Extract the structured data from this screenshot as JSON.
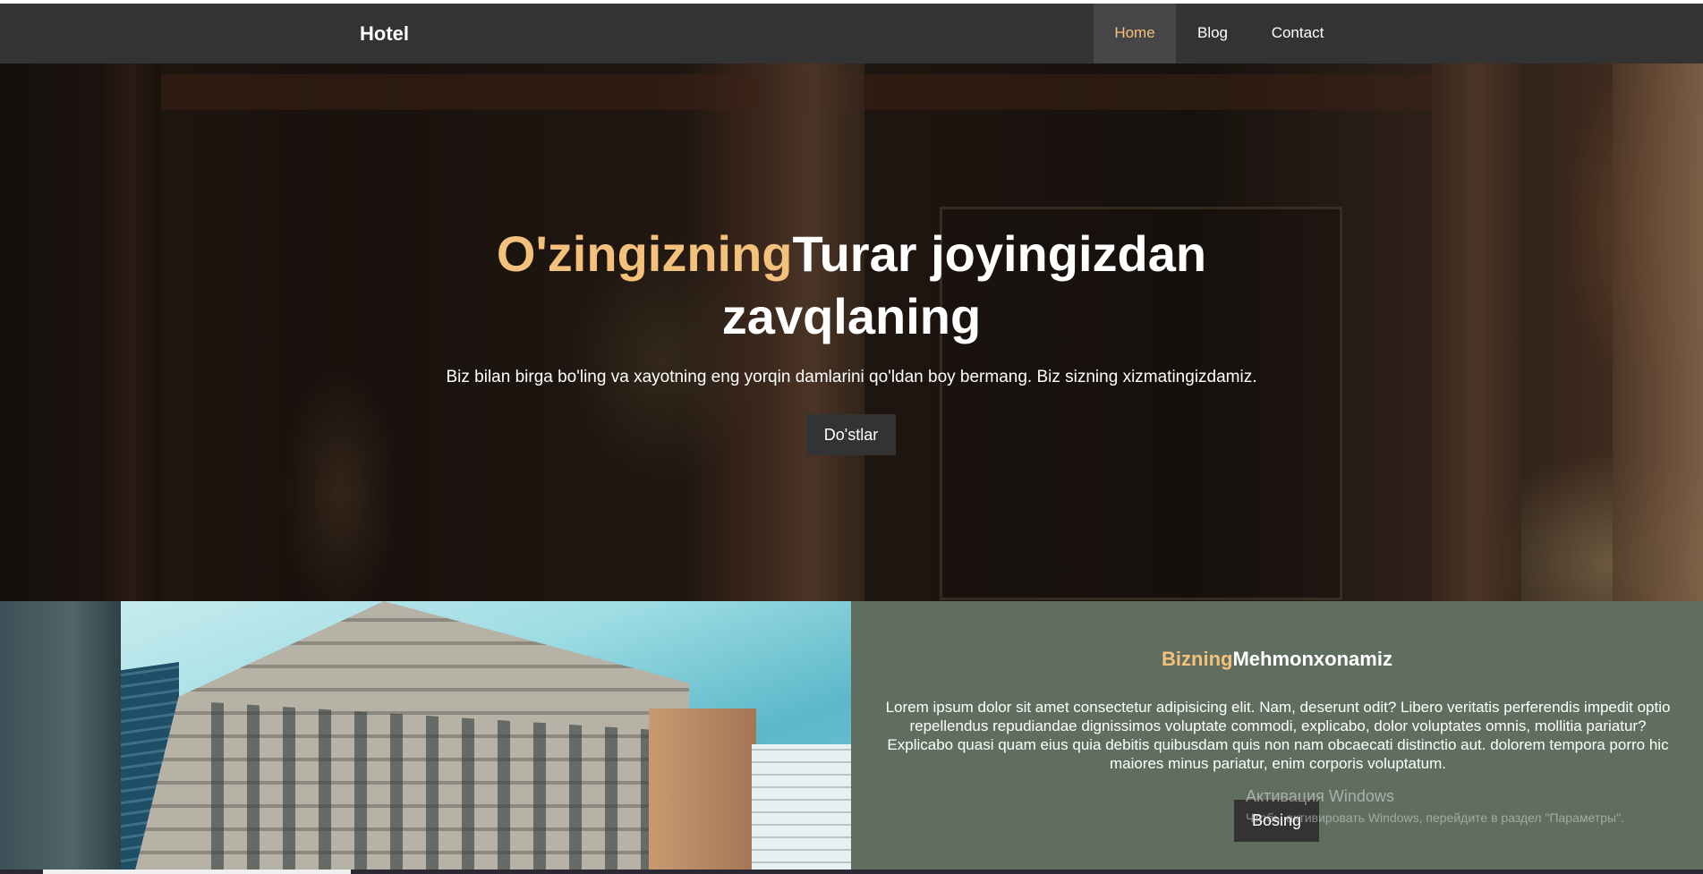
{
  "nav": {
    "logo": "Hotel",
    "items": [
      {
        "label": "Home",
        "active": true
      },
      {
        "label": "Blog",
        "active": false
      },
      {
        "label": "Contact",
        "active": false
      }
    ]
  },
  "hero": {
    "title_accent": "O'zingizning",
    "title_rest": "Turar joyingizdan zavqlaning",
    "subtitle": "Biz bilan birga bo'ling va xayotning eng yorqin damlarini qo'ldan boy bermang. Biz sizning xizmatingizdamiz.",
    "button_label": "Do'stlar"
  },
  "about": {
    "title_accent": "Bizning",
    "title_rest": "Mehmonxonamiz",
    "text": "Lorem ipsum dolor sit amet consectetur adipisicing elit. Nam, deserunt odit? Libero veritatis perferendis impedit optio repellendus repudiandae dignissimos voluptate commodi, explicabo, dolor voluptates omnis, mollitia pariatur? Explicabo quasi quam eius quia debitis quibusdam quis non nam obcaecati distinctio aut. dolorem tempora porro hic maiores minus pariatur, enim corporis voluptatum.",
    "button_label": "Bosing"
  },
  "os_watermark": {
    "title": "Активация Windows",
    "subtitle": "Чтобы активировать Windows, перейдите в раздел \"Параметры\"."
  },
  "colors": {
    "accent": "#f4c17c",
    "navbar": "#333333",
    "about_bg": "#5f6e5f"
  }
}
